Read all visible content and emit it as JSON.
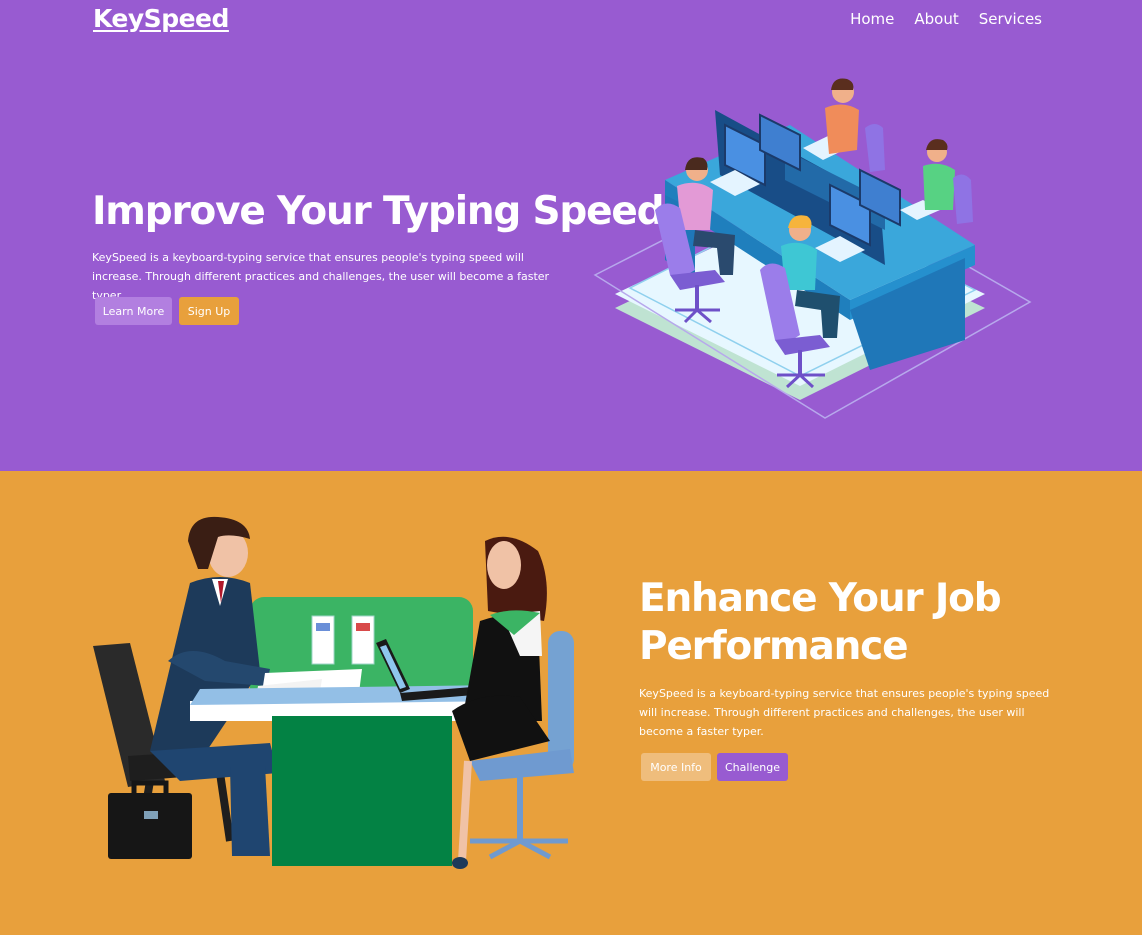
{
  "header": {
    "logo": "KeySpeed",
    "nav": [
      "Home",
      "About",
      "Services"
    ]
  },
  "hero": {
    "title": "Improve Your Typing Speed",
    "description": "KeySpeed is a keyboard-typing service that ensures people's typing speed will increase. Through different practices and challenges, the user will become a faster typer.",
    "buttons": {
      "learn_more": "Learn More",
      "sign_up": "Sign Up"
    }
  },
  "job": {
    "title": "Enhance Your Job Performance",
    "description": "KeySpeed is a keyboard-typing service that ensures people's typing speed will increase. Through different practices and challenges, the user will become a faster typer.",
    "buttons": {
      "more_info": "More Info",
      "challenge": "Challenge"
    }
  },
  "colors": {
    "purple": "#985bd1",
    "orange": "#e8a03c",
    "light_purple_button": "#b27fe0",
    "light_orange_button": "#efbd7c"
  },
  "icons": [
    "office-typists-illustration",
    "job-interview-illustration"
  ]
}
